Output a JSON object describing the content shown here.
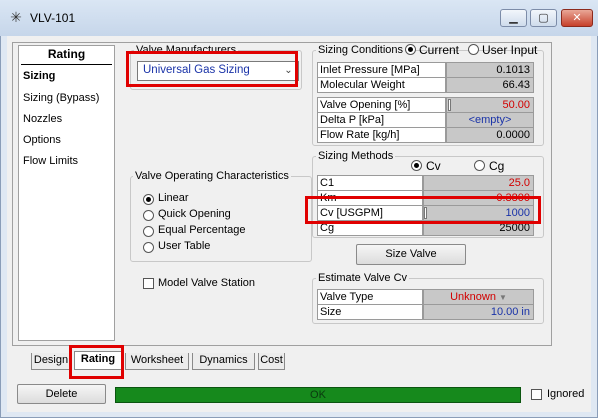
{
  "window": {
    "title": "VLV-101",
    "icon": "asterisk-icon"
  },
  "title_buttons": {
    "minimize": "minimize-icon",
    "maximize": "maximize-icon",
    "close": "close-icon"
  },
  "nav": {
    "header": "Rating",
    "items": [
      {
        "label": "Sizing",
        "active": true
      },
      {
        "label": "Sizing (Bypass)"
      },
      {
        "label": "Nozzles"
      },
      {
        "label": "Options"
      },
      {
        "label": "Flow Limits"
      }
    ]
  },
  "valve_manufacturers": {
    "label": "Valve Manufacturers",
    "selected": "Universal Gas Sizing"
  },
  "operating_characteristics": {
    "label": "Valve Operating Characteristics",
    "options": [
      {
        "label": "Linear",
        "selected": true
      },
      {
        "label": "Quick Opening"
      },
      {
        "label": "Equal Percentage"
      },
      {
        "label": "User Table"
      }
    ]
  },
  "model_valve_station": {
    "label": "Model Valve Station",
    "checked": false
  },
  "sizing_conditions": {
    "label": "Sizing Conditions",
    "radio_current": "Current",
    "radio_user_input": "User Input",
    "selected": "Current",
    "rows_a": [
      {
        "label": "Inlet Pressure [MPa]",
        "value": "0.1013",
        "color": "black"
      },
      {
        "label": "Molecular Weight",
        "value": "66.43",
        "color": "black"
      }
    ],
    "rows_b": [
      {
        "label": "Valve Opening [%]",
        "value": "50.00",
        "color": "red"
      },
      {
        "label": "Delta P [kPa]",
        "value": "<empty>",
        "color": "blue-center"
      },
      {
        "label": "Flow Rate [kg/h]",
        "value": "0.0000",
        "color": "black"
      }
    ]
  },
  "sizing_methods": {
    "label": "Sizing Methods",
    "radio_cv": "Cv",
    "radio_cg": "Cg",
    "selected": "Cv",
    "rows": [
      {
        "label": "C1",
        "value": "25.0",
        "color": "red"
      },
      {
        "label": "Km",
        "value": "0.3800",
        "color": "red"
      },
      {
        "label": "Cv [USGPM]",
        "value": "1000",
        "color": "blue"
      },
      {
        "label": "Cg",
        "value": "25000",
        "color": "black"
      }
    ]
  },
  "size_valve_button": "Size Valve",
  "estimate_valve_cv": {
    "label": "Estimate Valve Cv",
    "rows": [
      {
        "label": "Valve Type",
        "value": "Unknown",
        "color": "red-center"
      },
      {
        "label": "Size",
        "value": "10.00 in",
        "color": "blue"
      }
    ]
  },
  "tabs": [
    {
      "label": "Design"
    },
    {
      "label": "Rating",
      "active": true
    },
    {
      "label": "Worksheet"
    },
    {
      "label": "Dynamics"
    },
    {
      "label": "Cost"
    }
  ],
  "bottom": {
    "delete_label": "Delete",
    "status": "OK",
    "ignored_label": "Ignored"
  },
  "colors": {
    "highlight": "#e00000",
    "status_ok": "#16891c",
    "value_blue": "#1a33a8",
    "value_red": "#d20000"
  }
}
